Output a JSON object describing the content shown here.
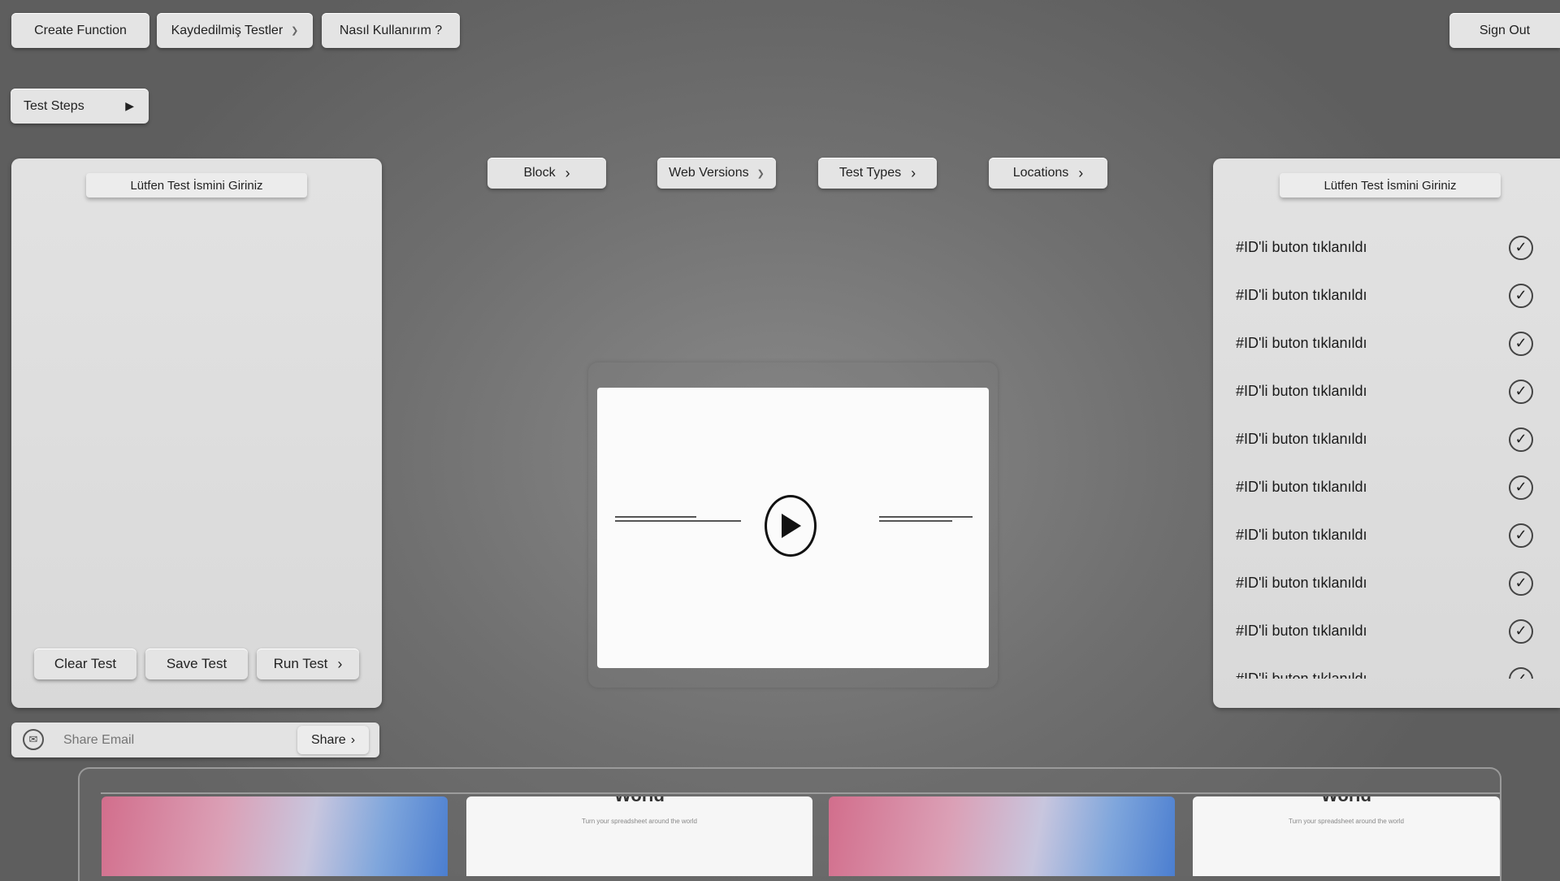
{
  "topbar": {
    "create_function": "Create Function",
    "saved_tests": "Kaydedilmiş Testler",
    "how_to_use": "Nasıl Kullanırım ?",
    "sign_out": "Sign Out"
  },
  "test_steps_button": "Test Steps",
  "toolbar": {
    "block": "Block",
    "web_versions": "Web Versions",
    "test_types": "Test Types",
    "locations": "Locations"
  },
  "left_panel": {
    "title": "Lütfen Test İsmini Giriniz",
    "clear_test": "Clear Test",
    "save_test": "Save Test",
    "run_test": "Run Test"
  },
  "share": {
    "placeholder": "Share Email",
    "button": "Share"
  },
  "right_panel": {
    "title": "Lütfen Test İsmini Giriniz",
    "steps": [
      "#ID'li buton tıklanıldı",
      "#ID'li buton tıklanıldı",
      "#ID'li buton tıklanıldı",
      "#ID'li buton tıklanıldı",
      "#ID'li buton tıklanıldı",
      "#ID'li buton tıklanıldı",
      "#ID'li buton tıklanıldı",
      "#ID'li buton tıklanıldı",
      "#ID'li buton tıklanıldı",
      "#ID'li buton tıklanıldı"
    ]
  },
  "thumbnails": {
    "world_label": "World",
    "world_caption": "Turn your spreadsheet around the world"
  },
  "icons": {
    "mail": "mail-icon",
    "play": "play-icon",
    "check": "check-circle-icon",
    "chevron": "chevron-right-icon"
  }
}
